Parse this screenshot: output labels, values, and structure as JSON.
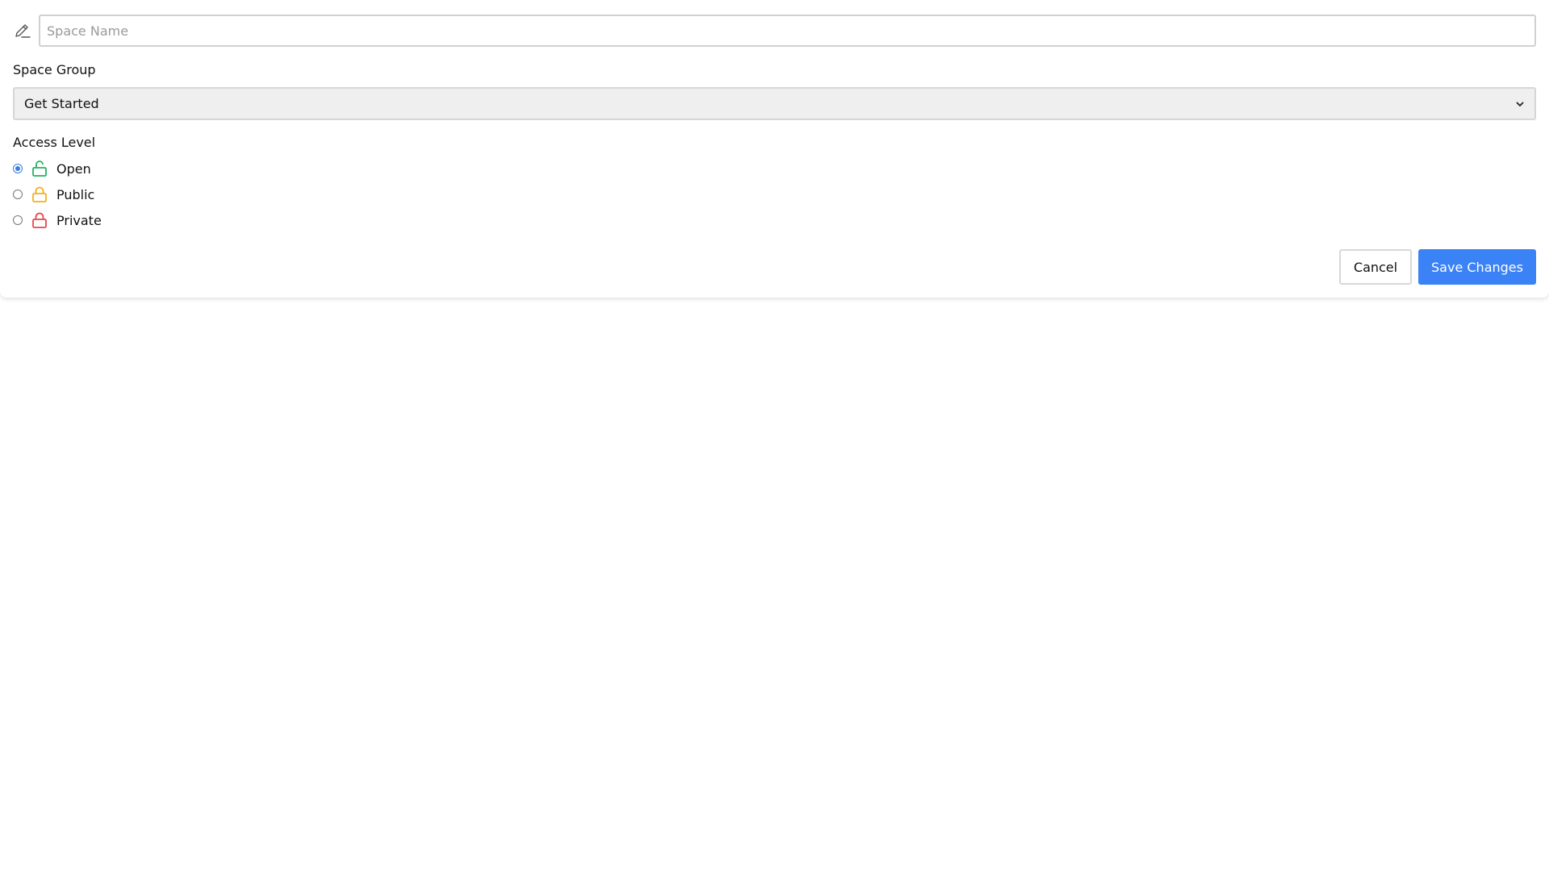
{
  "form": {
    "name_placeholder": "Space Name",
    "name_value": "",
    "group_label": "Space Group",
    "group_selected": "Get Started",
    "access_label": "Access Level",
    "access_options": [
      {
        "label": "Open",
        "icon": "unlocked-icon",
        "color": "#22b35c",
        "selected": true
      },
      {
        "label": "Public",
        "icon": "lock-icon",
        "color": "#f2b01e",
        "selected": false
      },
      {
        "label": "Private",
        "icon": "lock-icon",
        "color": "#e5484d",
        "selected": false
      }
    ]
  },
  "actions": {
    "cancel_label": "Cancel",
    "save_label": "Save Changes"
  },
  "colors": {
    "accent": "#3b82f6",
    "open": "#22b35c",
    "public": "#f2b01e",
    "private": "#e5484d"
  }
}
